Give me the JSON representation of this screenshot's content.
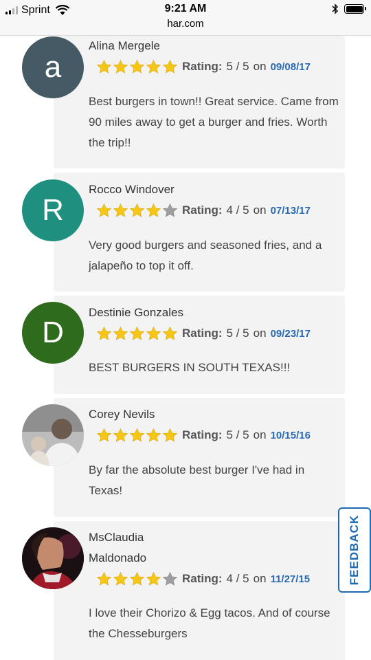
{
  "status_bar": {
    "carrier": "Sprint",
    "time": "9:21 AM",
    "url": "har.com"
  },
  "reviews": [
    {
      "name": "Alina Mergele",
      "initial": "a",
      "avatar_color": "#455a64",
      "rating_label": "Rating:",
      "rating_value": "5 / 5",
      "stars": 5,
      "on": "on",
      "date": "09/08/17",
      "text": "Best burgers in town!! Great service. Came from 90 miles away to get a burger and fries. Worth the trip!!"
    },
    {
      "name": "Rocco Windover",
      "initial": "R",
      "avatar_color": "#1f8f7f",
      "rating_label": "Rating:",
      "rating_value": "4 / 5",
      "stars": 4,
      "on": "on",
      "date": "07/13/17",
      "text": "Very good burgers and seasoned fries, and a jalapeño to top it off."
    },
    {
      "name": "Destinie Gonzales",
      "initial": "D",
      "avatar_color": "#2e6b1c",
      "rating_label": "Rating:",
      "rating_value": "5 / 5",
      "stars": 5,
      "on": "on",
      "date": "09/23/17",
      "text": "BEST BURGERS IN SOUTH TEXAS!!!"
    },
    {
      "name": "Corey Nevils",
      "rating_label": "Rating:",
      "rating_value": "5 / 5",
      "stars": 5,
      "on": "on",
      "date": "10/15/16",
      "text": "By far the absolute best burger I've had in Texas!"
    },
    {
      "name": "MsClaudia Maldonado",
      "rating_label": "Rating:",
      "rating_value": "4 / 5",
      "stars": 4,
      "on": "on",
      "date": "11/27/15",
      "text": "I love their Chorizo & Egg tacos. And of course the Chesseburgers"
    }
  ],
  "feedback_label": "FEEDBACK",
  "colors": {
    "star_filled": "#f5c518",
    "star_empty": "#9e9e9e",
    "date_link": "#2a69b3",
    "feedback_border": "#1e6ab0"
  }
}
